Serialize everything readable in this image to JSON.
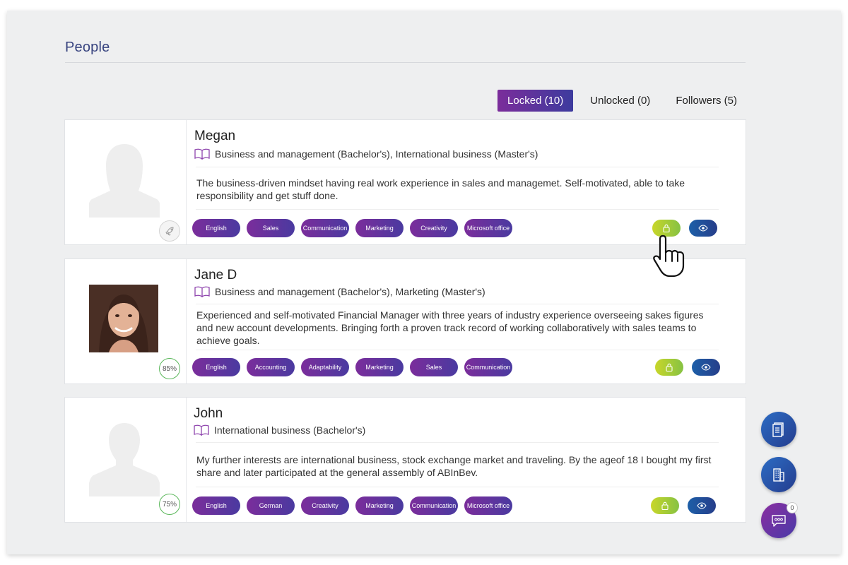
{
  "page": {
    "title": "People"
  },
  "tabs": [
    {
      "label": "Locked (10)",
      "active": true
    },
    {
      "label": "Unlocked (0)",
      "active": false
    },
    {
      "label": "Followers (5)",
      "active": false
    }
  ],
  "profiles": [
    {
      "name": "Megan",
      "education": "Business and management (Bachelor's), International business (Master's)",
      "description": "The business-driven mindset having real work experience in sales and managemet. Self-motivated, able to take responsibility and get stuff done.",
      "skills": [
        "English",
        "Sales",
        "Communication",
        "Marketing",
        "Creativity",
        "Microsoft office"
      ],
      "avatar": "female-silhouette",
      "badge_icon": "rocket-icon"
    },
    {
      "name": "Jane D",
      "education": "Business and management (Bachelor's), Marketing (Master's)",
      "description": "Experienced and self-motivated Financial Manager with three years of industry experience overseeing sakes figures and new account developments. Bringing forth a proven track record of working collaboratively with sales teams to achieve goals.",
      "skills": [
        "English",
        "Accounting",
        "Adaptability",
        "Marketing",
        "Sales",
        "Communication"
      ],
      "avatar": "photo",
      "progress": "85%"
    },
    {
      "name": "John",
      "education": "International business (Bachelor's)",
      "description": "My further interests are international business, stock exchange market and traveling. By the ageof 18 I bought my first share and later participated at the general assembly of ABInBev.",
      "skills": [
        "English",
        "German",
        "Creativity",
        "Marketing",
        "Communication",
        "Microsoft office"
      ],
      "avatar": "male-silhouette",
      "progress": "75%"
    }
  ],
  "floating": {
    "chat_count": "0"
  },
  "colors": {
    "accent_purple": "#7b2d9b",
    "accent_blue": "#253d8e",
    "lock_green": "#c8d62a",
    "progress_green": "#5cb85c"
  }
}
